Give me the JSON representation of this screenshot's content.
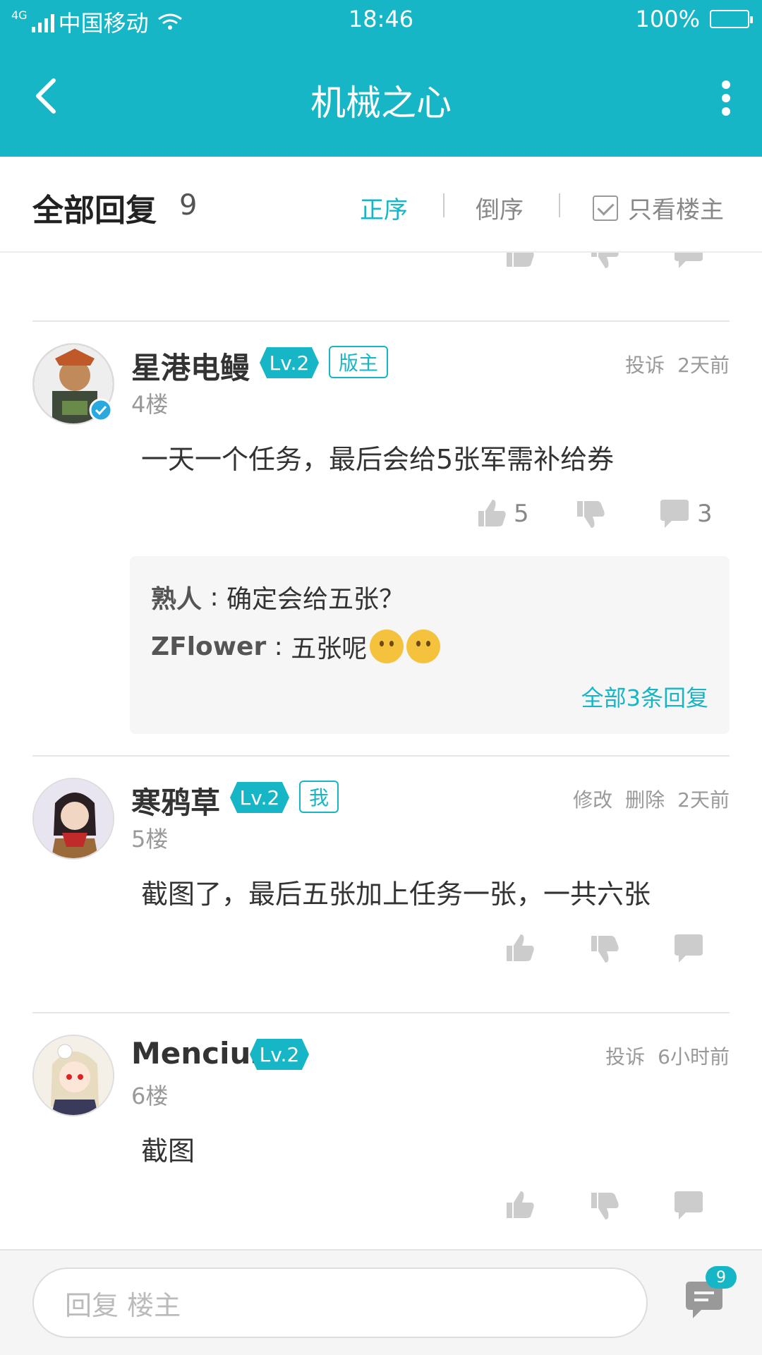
{
  "status": {
    "network": "4G",
    "carrier": "中国移动",
    "time": "18:46",
    "battery": "100%"
  },
  "header": {
    "title": "机械之心"
  },
  "filter": {
    "heading": "全部回复",
    "count": "9",
    "asc": "正序",
    "desc": "倒序",
    "only_op": "只看楼主"
  },
  "posts": [
    {
      "name": "星港电鳗",
      "level": "Lv.2",
      "tag": "版主",
      "meta1": "投诉",
      "time": "2天前",
      "floor": "4楼",
      "text": "一天一个任务，最后会给5张军需补给券",
      "likes": "5",
      "comments": "3",
      "replies": [
        {
          "who": "熟人",
          "text": "确定会给五张？"
        },
        {
          "who": "ZFlower",
          "text": "五张呢"
        }
      ],
      "all_replies": "全部3条回复"
    },
    {
      "name": "寒鸦草",
      "level": "Lv.2",
      "tag": "我",
      "meta0": "修改",
      "meta1": "删除",
      "time": "2天前",
      "floor": "5楼",
      "text": "截图了，最后五张加上任务一张，一共六张"
    },
    {
      "name": "Mencius",
      "level": "Lv.2",
      "meta1": "投诉",
      "time": "6小时前",
      "floor": "6楼",
      "text": "截图"
    }
  ],
  "bottom": {
    "placeholder": "回复  楼主",
    "badge": "9"
  },
  "colors": {
    "accent": "#17b6c6"
  }
}
